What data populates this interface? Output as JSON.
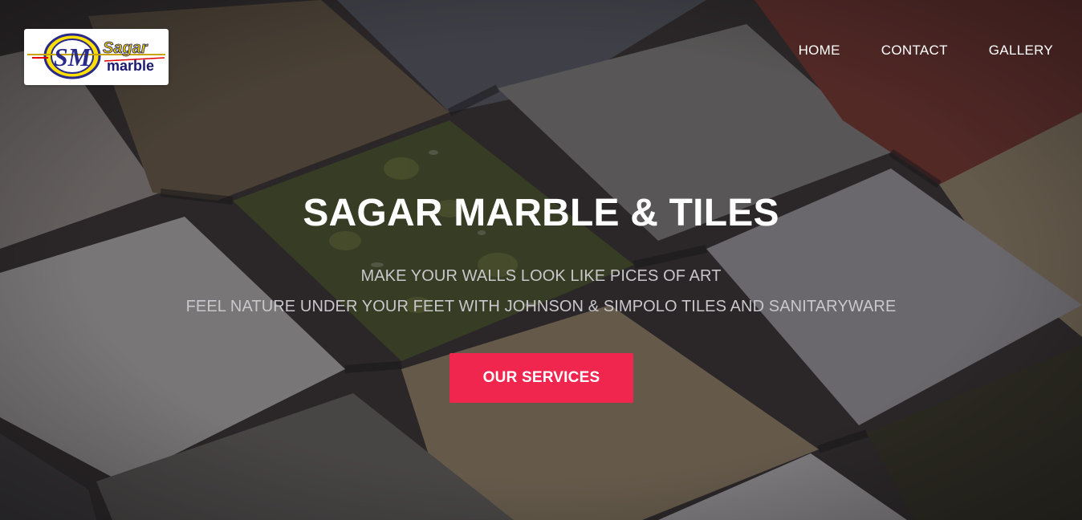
{
  "brand": {
    "logo_name_top": "Sagar",
    "logo_name_bottom": "marble",
    "logo_monogram": "SM"
  },
  "nav": {
    "items": [
      {
        "label": "HOME"
      },
      {
        "label": "CONTACT"
      },
      {
        "label": "GALLERY"
      }
    ]
  },
  "hero": {
    "title": "SAGAR MARBLE & TILES",
    "subtitle_line1": "MAKE YOUR WALLS LOOK LIKE PICES OF ART",
    "subtitle_line2": "FEEL NATURE UNDER YOUR FEET WITH JOHNSON & SIMPOLO TILES AND SANITARYWARE",
    "button_label": "OUR SERVICES"
  },
  "colors": {
    "accent": "#f0264f",
    "text_primary": "#ffffff",
    "text_secondary": "#c9c7cc"
  }
}
